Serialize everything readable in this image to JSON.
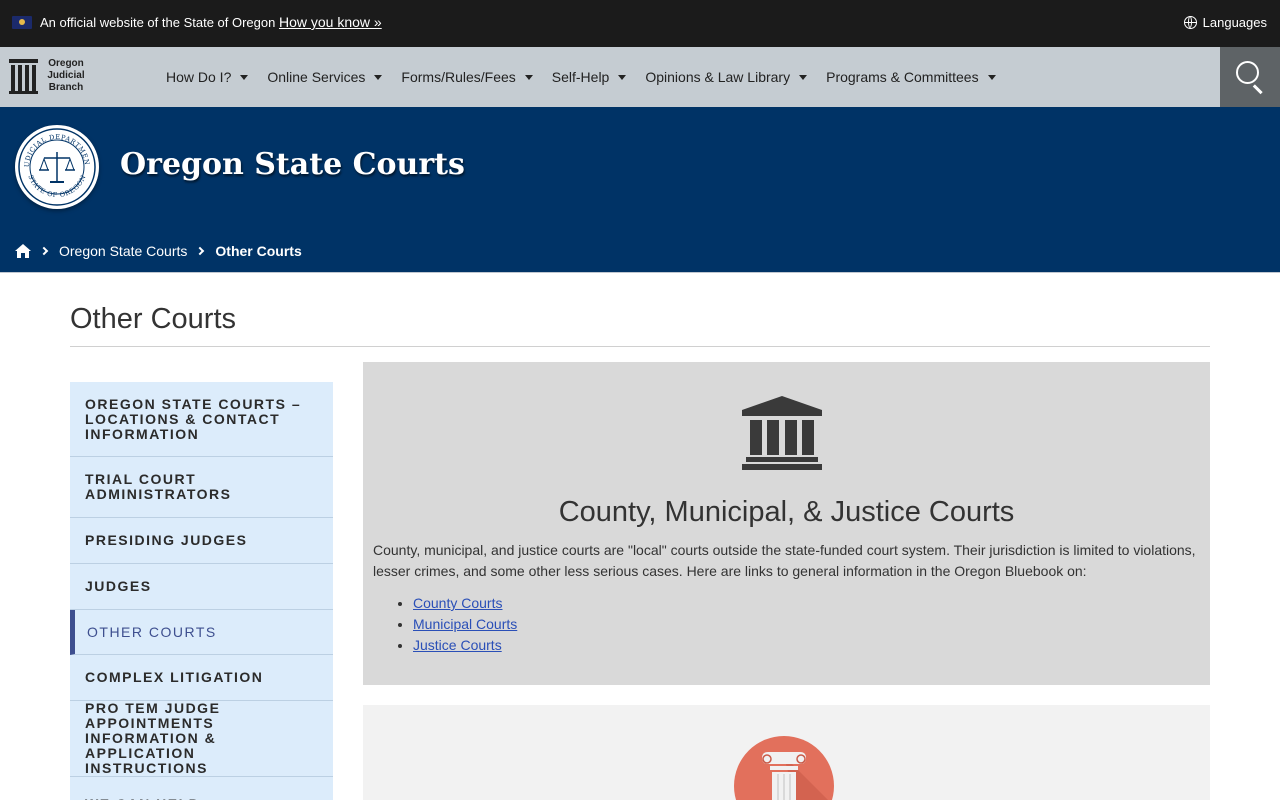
{
  "official_bar": {
    "text": "An official website of the State of Oregon",
    "how_link": "How you know »",
    "languages": "Languages"
  },
  "logo": {
    "line1": "Oregon",
    "line2": "Judicial",
    "line3": "Branch"
  },
  "nav": {
    "items": [
      {
        "label": "How Do I?"
      },
      {
        "label": "Online Services"
      },
      {
        "label": "Forms/Rules/Fees"
      },
      {
        "label": "Self-Help"
      },
      {
        "label": "Opinions & Law Library"
      },
      {
        "label": "Programs & Committees"
      }
    ]
  },
  "banner": {
    "title": "Oregon State Courts",
    "seal_text_top": "JUDICIAL DEPARTMENT",
    "seal_text_bottom": "STATE OF OREGON"
  },
  "breadcrumb": {
    "items": [
      "Oregon State Courts",
      "Other Courts"
    ]
  },
  "page": {
    "title": "Other Courts"
  },
  "sidebar": {
    "items": [
      {
        "label": "Oregon State Courts – Locations & Contact Information",
        "active": false
      },
      {
        "label": "Trial Court Administrators",
        "active": false
      },
      {
        "label": "Presiding Judges",
        "active": false
      },
      {
        "label": "Judges",
        "active": false
      },
      {
        "label": "Other Courts",
        "active": true
      },
      {
        "label": "Complex Litigation",
        "active": false
      },
      {
        "label": "Pro Tem Judge Appointments Information & Application Instructions",
        "active": false
      },
      {
        "label": "We Can Help",
        "active": false
      }
    ]
  },
  "card": {
    "heading": "County, Municipal, & Justice Courts",
    "description": "County, municipal, and justice courts are \"local\" courts outside the state-funded court system. Their jurisdiction is limited to violations, lesser crimes, and some other less serious cases. Here are links to general information in the Oregon Bluebook on:",
    "links": [
      "County Courts",
      "Municipal Courts",
      "Justice Courts"
    ]
  },
  "colors": {
    "official_bar_bg": "#1b1b1b",
    "nav_bg": "#c5ccd2",
    "banner_bg": "#003366",
    "sidebar_bg": "#dcecfb",
    "active_accent": "#3e4f8f",
    "link": "#2a4fb7",
    "card_bg": "#d9d9d9",
    "column_icon_bg": "#e2705c"
  },
  "icons": [
    "oregon-flag-icon",
    "globe-icon",
    "search-icon",
    "home-icon",
    "courthouse-icon",
    "column-icon",
    "judicial-seal-icon"
  ]
}
